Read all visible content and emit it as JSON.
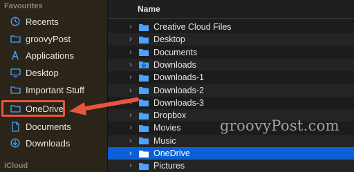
{
  "sidebar": {
    "favourites_label": "Favourites",
    "icloud_label": "iCloud",
    "items": [
      {
        "label": "Recents",
        "icon": "clock-icon"
      },
      {
        "label": "groovyPost",
        "icon": "folder-icon"
      },
      {
        "label": "Applications",
        "icon": "applications-icon"
      },
      {
        "label": "Desktop",
        "icon": "desktop-icon"
      },
      {
        "label": "Important Stuff",
        "icon": "folder-icon"
      },
      {
        "label": "OneDrive",
        "icon": "folder-icon"
      },
      {
        "label": "Documents",
        "icon": "document-icon"
      },
      {
        "label": "Downloads",
        "icon": "download-icon"
      }
    ]
  },
  "main": {
    "column_name": "Name",
    "rows": [
      {
        "label": "Creative Cloud Files",
        "icon": "folder-icon"
      },
      {
        "label": "Desktop",
        "icon": "folder-icon"
      },
      {
        "label": "Documents",
        "icon": "folder-icon"
      },
      {
        "label": "Downloads",
        "icon": "downloads-folder-icon"
      },
      {
        "label": "Downloads-1",
        "icon": "folder-icon"
      },
      {
        "label": "Downloads-2",
        "icon": "folder-icon"
      },
      {
        "label": "Downloads-3",
        "icon": "folder-icon"
      },
      {
        "label": "Dropbox",
        "icon": "folder-icon"
      },
      {
        "label": "Movies",
        "icon": "folder-icon"
      },
      {
        "label": "Music",
        "icon": "folder-icon"
      },
      {
        "label": "OneDrive",
        "icon": "folder-icon",
        "selected": true
      },
      {
        "label": "Pictures",
        "icon": "folder-icon"
      }
    ]
  },
  "watermark": "groovyPost.com",
  "colors": {
    "accent": "#0a60d6",
    "highlight": "#e8553e",
    "folder": "#4aa3ff"
  }
}
